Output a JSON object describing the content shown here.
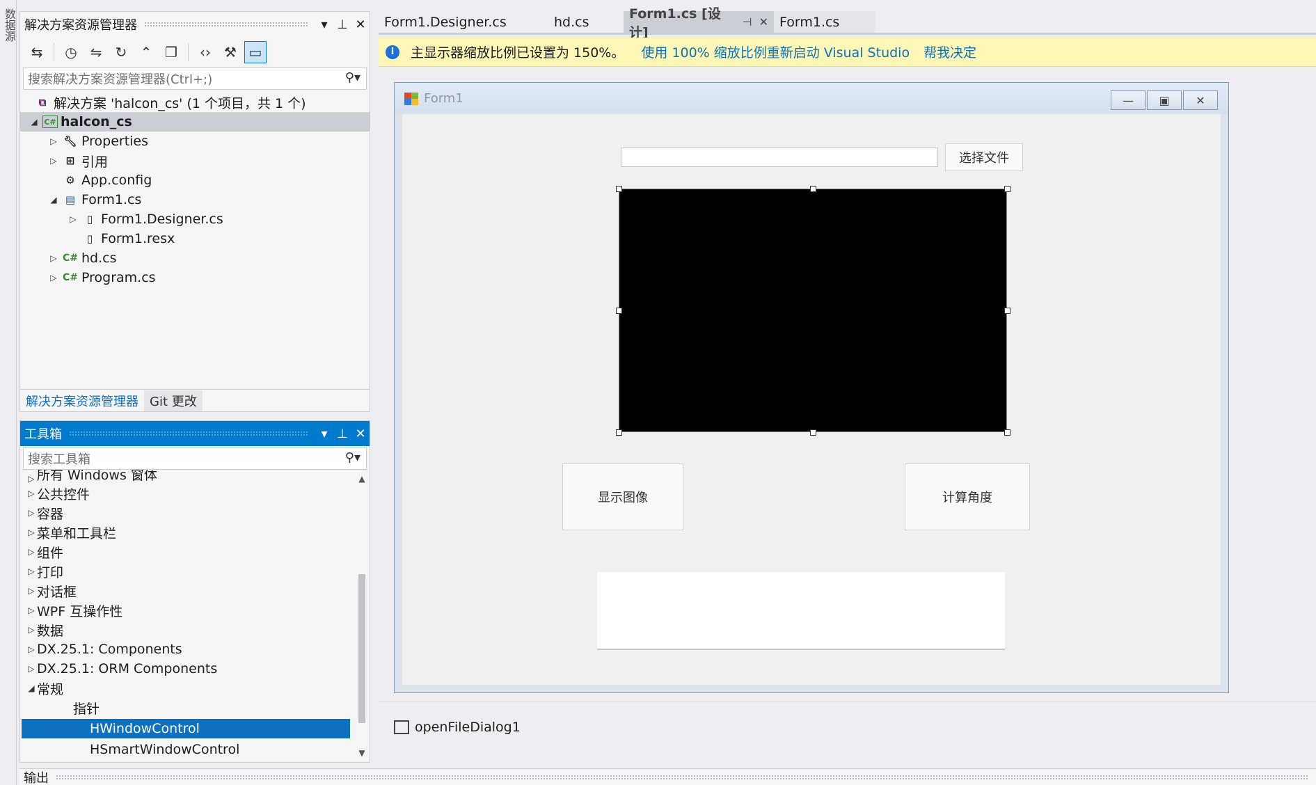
{
  "left_strip": {
    "label": "数据源"
  },
  "solution_explorer": {
    "title": "解决方案资源管理器",
    "search_placeholder": "搜索解决方案资源管理器(Ctrl+;)",
    "tree": [
      {
        "label": "解决方案 'halcon_cs' (1 个项目，共 1 个)",
        "icon": "solution-icon"
      },
      {
        "label": "halcon_cs",
        "icon": "csharp-project-icon",
        "icon_text": "C#"
      },
      {
        "label": "Properties",
        "icon": "wrench-icon"
      },
      {
        "label": "引用",
        "icon": "references-icon"
      },
      {
        "label": "App.config",
        "icon": "config-file-icon"
      },
      {
        "label": "Form1.cs",
        "icon": "form-icon"
      },
      {
        "label": "Form1.Designer.cs",
        "icon": "file-icon"
      },
      {
        "label": "Form1.resx",
        "icon": "file-icon"
      },
      {
        "label": "hd.cs",
        "icon": "csharp-file-icon",
        "icon_text": "C#"
      },
      {
        "label": "Program.cs",
        "icon": "csharp-file-icon",
        "icon_text": "C#"
      }
    ],
    "tabs": {
      "solution": "解决方案资源管理器",
      "git": "Git 更改"
    }
  },
  "toolbox": {
    "title": "工具箱",
    "search_placeholder": "搜索工具箱",
    "items": [
      "所有 Windows 窗体",
      "公共控件",
      "容器",
      "菜单和工具栏",
      "组件",
      "打印",
      "对话框",
      "WPF 互操作性",
      "数据",
      "DX.25.1: Components",
      "DX.25.1: ORM Components",
      "常规"
    ],
    "general_items": [
      "指针",
      "HWindowControl",
      "HSmartWindowControl"
    ]
  },
  "output": {
    "title": "输出"
  },
  "doc_tabs": [
    {
      "label": "Form1.Designer.cs"
    },
    {
      "label": "hd.cs"
    },
    {
      "label": "Form1.cs [设计]"
    },
    {
      "label": "Form1.cs"
    }
  ],
  "info_bar": {
    "message": "主显示器缩放比例已设置为 150%。",
    "link_restart": "使用 100% 缩放比例重新启动 Visual Studio",
    "link_help": "帮我决定"
  },
  "form": {
    "title": "Form1",
    "select_file_button": "选择文件",
    "show_image_button": "显示图像",
    "calc_angle_button": "计算角度"
  },
  "tray": {
    "component": "openFileDialog1"
  },
  "colors": {
    "accent": "#007acc",
    "info_bar": "#fcf7b6",
    "selection": "#0e70c0"
  }
}
